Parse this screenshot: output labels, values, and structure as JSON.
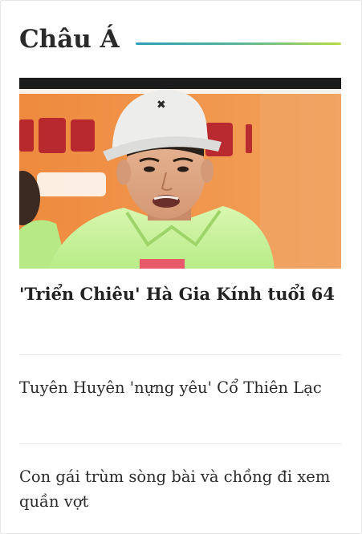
{
  "section": {
    "title": "Châu Á",
    "accent_gradient": [
      "#2f9fb8",
      "#59b49a",
      "#b6dd43"
    ]
  },
  "featured": {
    "image_icon": "photo-man-white-cap",
    "title": "'Triển Chiêu' Hà Gia Kính tuổi 64"
  },
  "stories": [
    {
      "title": "Tuyên Huyên 'nựng yêu' Cổ Thiên Lạc"
    },
    {
      "title": "Con gái trùm sòng bài và chồng đi xem quần vợt"
    }
  ]
}
